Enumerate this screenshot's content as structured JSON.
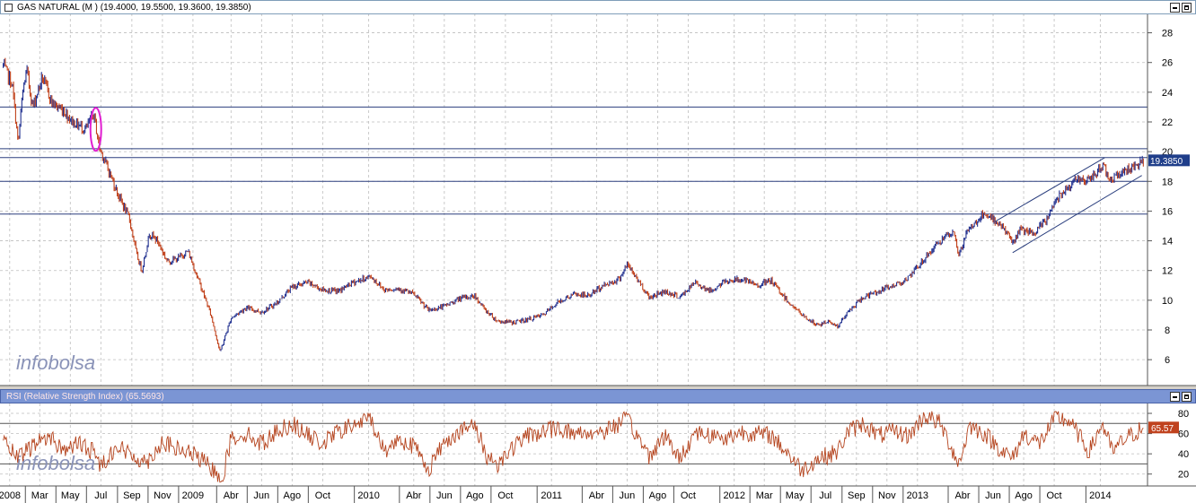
{
  "price_panel": {
    "header": "GAS NATURAL (M ) (19.4000, 19.5500, 19.3600, 19.3850)",
    "last_value_label": "19.3850",
    "watermark": "infobolsa"
  },
  "rsi_panel": {
    "header": "RSI (Relative Strength Index) (65.5693)",
    "last_value_label": "65.57",
    "watermark": "infobolsa"
  },
  "colors": {
    "candle_up": "#1f2f8f",
    "candle_down": "#c0401a",
    "rsi_line": "#b5441e",
    "hline": "#2b3f7e",
    "highlight": "#e01ed0",
    "grid": "#bdbdbd",
    "last_value_bg": "#1f3e8a",
    "rsi_value_bg": "#c0421e"
  },
  "chart_data": [
    {
      "type": "line",
      "name": "GAS NATURAL",
      "ylim": [
        4.5,
        29
      ],
      "yticks": [
        6,
        8,
        10,
        12,
        14,
        16,
        18,
        20,
        22,
        24,
        26,
        28
      ],
      "x_range": [
        "2008-01-01",
        "2014-03-31"
      ],
      "keypoints": [
        [
          "2008-01-02",
          25.8
        ],
        [
          "2008-01-20",
          24.5
        ],
        [
          "2008-02-01",
          20.5
        ],
        [
          "2008-02-10",
          24.0
        ],
        [
          "2008-02-18",
          25.5
        ],
        [
          "2008-03-01",
          23.0
        ],
        [
          "2008-03-20",
          25.0
        ],
        [
          "2008-04-10",
          23.2
        ],
        [
          "2008-05-01",
          22.8
        ],
        [
          "2008-05-20",
          22.0
        ],
        [
          "2008-06-15",
          21.5
        ],
        [
          "2008-07-01",
          22.5
        ],
        [
          "2008-07-12",
          20.3
        ],
        [
          "2008-07-25",
          19.2
        ],
        [
          "2008-08-20",
          17.0
        ],
        [
          "2008-09-10",
          15.5
        ],
        [
          "2008-09-25",
          13.0
        ],
        [
          "2008-10-05",
          12.0
        ],
        [
          "2008-10-20",
          14.5
        ],
        [
          "2008-11-05",
          14.0
        ],
        [
          "2008-11-25",
          12.6
        ],
        [
          "2008-12-15",
          12.8
        ],
        [
          "2009-01-05",
          13.3
        ],
        [
          "2009-01-30",
          11.0
        ],
        [
          "2009-02-20",
          9.0
        ],
        [
          "2009-03-10",
          6.5
        ],
        [
          "2009-04-01",
          8.8
        ],
        [
          "2009-05-01",
          9.5
        ],
        [
          "2009-06-01",
          9.2
        ],
        [
          "2009-07-01",
          9.8
        ],
        [
          "2009-08-01",
          10.9
        ],
        [
          "2009-09-01",
          11.2
        ],
        [
          "2009-10-01",
          10.7
        ],
        [
          "2009-11-01",
          10.6
        ],
        [
          "2009-12-01",
          11.2
        ],
        [
          "2010-01-05",
          11.6
        ],
        [
          "2010-02-01",
          10.7
        ],
        [
          "2010-03-01",
          10.8
        ],
        [
          "2010-04-01",
          10.4
        ],
        [
          "2010-05-01",
          9.3
        ],
        [
          "2010-06-01",
          9.6
        ],
        [
          "2010-07-01",
          10.1
        ],
        [
          "2010-08-01",
          10.3
        ],
        [
          "2010-08-20",
          9.4
        ],
        [
          "2010-09-15",
          8.6
        ],
        [
          "2010-10-15",
          8.5
        ],
        [
          "2010-11-15",
          8.7
        ],
        [
          "2010-12-15",
          9.0
        ],
        [
          "2011-01-15",
          9.9
        ],
        [
          "2011-02-15",
          10.4
        ],
        [
          "2011-03-15",
          10.3
        ],
        [
          "2011-04-15",
          11.0
        ],
        [
          "2011-05-15",
          11.4
        ],
        [
          "2011-06-01",
          12.4
        ],
        [
          "2011-06-20",
          11.5
        ],
        [
          "2011-07-15",
          10.2
        ],
        [
          "2011-08-15",
          10.6
        ],
        [
          "2011-09-15",
          10.2
        ],
        [
          "2011-10-15",
          11.2
        ],
        [
          "2011-11-15",
          10.6
        ],
        [
          "2011-12-15",
          11.3
        ],
        [
          "2012-01-15",
          11.4
        ],
        [
          "2012-02-15",
          11.0
        ],
        [
          "2012-03-15",
          11.3
        ],
        [
          "2012-04-15",
          10.0
        ],
        [
          "2012-05-15",
          9.0
        ],
        [
          "2012-06-15",
          8.3
        ],
        [
          "2012-07-10",
          8.6
        ],
        [
          "2012-07-25",
          8.2
        ],
        [
          "2012-08-15",
          9.2
        ],
        [
          "2012-09-15",
          10.2
        ],
        [
          "2012-10-15",
          10.6
        ],
        [
          "2012-11-15",
          11.0
        ],
        [
          "2012-12-15",
          11.5
        ],
        [
          "2013-01-15",
          12.8
        ],
        [
          "2013-02-15",
          14.0
        ],
        [
          "2013-03-15",
          14.5
        ],
        [
          "2013-03-25",
          13.0
        ],
        [
          "2013-04-10",
          14.6
        ],
        [
          "2013-05-10",
          15.7
        ],
        [
          "2013-06-10",
          15.3
        ],
        [
          "2013-06-30",
          14.5
        ],
        [
          "2013-07-10",
          13.8
        ],
        [
          "2013-07-25",
          14.8
        ],
        [
          "2013-08-20",
          14.4
        ],
        [
          "2013-09-15",
          15.4
        ],
        [
          "2013-10-05",
          16.8
        ],
        [
          "2013-10-25",
          17.6
        ],
        [
          "2013-11-20",
          18.2
        ],
        [
          "2013-12-10",
          18.0
        ],
        [
          "2014-01-05",
          19.1
        ],
        [
          "2014-01-20",
          18.2
        ],
        [
          "2014-02-10",
          18.5
        ],
        [
          "2014-03-01",
          18.9
        ],
        [
          "2014-03-28",
          19.385
        ]
      ],
      "horizontal_levels": [
        23.0,
        20.2,
        19.6,
        18.0,
        15.8
      ],
      "trend_channel": [
        [
          [
            "2013-06-05",
            15.3
          ],
          [
            "2014-01-10",
            19.6
          ]
        ],
        [
          [
            "2013-07-10",
            13.2
          ],
          [
            "2014-03-25",
            18.4
          ]
        ]
      ],
      "highlight_ellipse_center": [
        "2008-07-05",
        21.5
      ]
    },
    {
      "type": "line",
      "name": "RSI (Relative Strength Index)",
      "ylim": [
        10,
        88
      ],
      "yticks": [
        20,
        40,
        60,
        80
      ],
      "reference_levels": [
        30,
        70
      ],
      "keypoints": [
        [
          "2008-01-02",
          52
        ],
        [
          "2008-02-01",
          35
        ],
        [
          "2008-03-01",
          48
        ],
        [
          "2008-04-01",
          58
        ],
        [
          "2008-05-01",
          44
        ],
        [
          "2008-06-01",
          50
        ],
        [
          "2008-07-01",
          42
        ],
        [
          "2008-07-15",
          28
        ],
        [
          "2008-08-15",
          48
        ],
        [
          "2008-09-15",
          38
        ],
        [
          "2008-10-15",
          32
        ],
        [
          "2008-11-15",
          52
        ],
        [
          "2008-12-15",
          44
        ],
        [
          "2009-01-15",
          40
        ],
        [
          "2009-02-15",
          28
        ],
        [
          "2009-03-15",
          16
        ],
        [
          "2009-04-01",
          55
        ],
        [
          "2009-05-01",
          60
        ],
        [
          "2009-06-01",
          50
        ],
        [
          "2009-07-01",
          62
        ],
        [
          "2009-08-01",
          70
        ],
        [
          "2009-09-01",
          58
        ],
        [
          "2009-10-01",
          50
        ],
        [
          "2009-11-01",
          62
        ],
        [
          "2010-01-05",
          75
        ],
        [
          "2010-02-01",
          42
        ],
        [
          "2010-03-01",
          55
        ],
        [
          "2010-04-01",
          48
        ],
        [
          "2010-05-01",
          25
        ],
        [
          "2010-06-01",
          52
        ],
        [
          "2010-07-01",
          62
        ],
        [
          "2010-08-01",
          68
        ],
        [
          "2010-08-25",
          38
        ],
        [
          "2010-09-15",
          30
        ],
        [
          "2010-10-15",
          46
        ],
        [
          "2010-11-15",
          58
        ],
        [
          "2011-01-15",
          66
        ],
        [
          "2011-02-15",
          60
        ],
        [
          "2011-04-15",
          62
        ],
        [
          "2011-06-01",
          74
        ],
        [
          "2011-07-15",
          38
        ],
        [
          "2011-08-15",
          58
        ],
        [
          "2011-09-15",
          35
        ],
        [
          "2011-10-15",
          62
        ],
        [
          "2011-12-15",
          55
        ],
        [
          "2012-01-15",
          62
        ],
        [
          "2012-03-15",
          58
        ],
        [
          "2012-04-15",
          42
        ],
        [
          "2012-05-15",
          24
        ],
        [
          "2012-06-15",
          35
        ],
        [
          "2012-07-25",
          42
        ],
        [
          "2012-08-15",
          62
        ],
        [
          "2012-09-15",
          70
        ],
        [
          "2012-10-15",
          58
        ],
        [
          "2012-11-15",
          62
        ],
        [
          "2012-12-15",
          58
        ],
        [
          "2013-01-15",
          78
        ],
        [
          "2013-02-15",
          70
        ],
        [
          "2013-03-25",
          30
        ],
        [
          "2013-04-15",
          68
        ],
        [
          "2013-05-15",
          60
        ],
        [
          "2013-06-15",
          45
        ],
        [
          "2013-07-10",
          35
        ],
        [
          "2013-08-01",
          60
        ],
        [
          "2013-09-01",
          50
        ],
        [
          "2013-10-05",
          76
        ],
        [
          "2013-11-01",
          72
        ],
        [
          "2013-12-10",
          42
        ],
        [
          "2014-01-05",
          70
        ],
        [
          "2014-01-25",
          42
        ],
        [
          "2014-02-20",
          55
        ],
        [
          "2014-03-28",
          65.57
        ]
      ]
    }
  ],
  "x_axis": {
    "labels": [
      {
        "date": "2008-01-15",
        "text": "2008"
      },
      {
        "date": "2008-03-15",
        "text": "Mar"
      },
      {
        "date": "2008-05-15",
        "text": "May"
      },
      {
        "date": "2008-07-15",
        "text": "Jul"
      },
      {
        "date": "2008-09-15",
        "text": "Sep"
      },
      {
        "date": "2008-11-15",
        "text": "Nov"
      },
      {
        "date": "2009-01-15",
        "text": "2009"
      },
      {
        "date": "2009-04-01",
        "text": "Abr"
      },
      {
        "date": "2009-06-01",
        "text": "Jun"
      },
      {
        "date": "2009-08-01",
        "text": "Ago"
      },
      {
        "date": "2009-10-01",
        "text": "Oct"
      },
      {
        "date": "2010-01-01",
        "text": "2010"
      },
      {
        "date": "2010-04-01",
        "text": "Abr"
      },
      {
        "date": "2010-06-01",
        "text": "Jun"
      },
      {
        "date": "2010-08-01",
        "text": "Ago"
      },
      {
        "date": "2010-10-01",
        "text": "Oct"
      },
      {
        "date": "2011-01-01",
        "text": "2011"
      },
      {
        "date": "2011-04-01",
        "text": "Abr"
      },
      {
        "date": "2011-06-01",
        "text": "Jun"
      },
      {
        "date": "2011-08-01",
        "text": "Ago"
      },
      {
        "date": "2011-10-01",
        "text": "Oct"
      },
      {
        "date": "2012-01-01",
        "text": "2012"
      },
      {
        "date": "2012-03-01",
        "text": "Mar"
      },
      {
        "date": "2012-05-01",
        "text": "May"
      },
      {
        "date": "2012-07-01",
        "text": "Jul"
      },
      {
        "date": "2012-09-01",
        "text": "Sep"
      },
      {
        "date": "2012-11-01",
        "text": "Nov"
      },
      {
        "date": "2013-01-01",
        "text": "2013"
      },
      {
        "date": "2013-04-01",
        "text": "Abr"
      },
      {
        "date": "2013-06-01",
        "text": "Jun"
      },
      {
        "date": "2013-08-01",
        "text": "Ago"
      },
      {
        "date": "2013-10-01",
        "text": "Oct"
      },
      {
        "date": "2014-01-01",
        "text": "2014"
      }
    ]
  }
}
